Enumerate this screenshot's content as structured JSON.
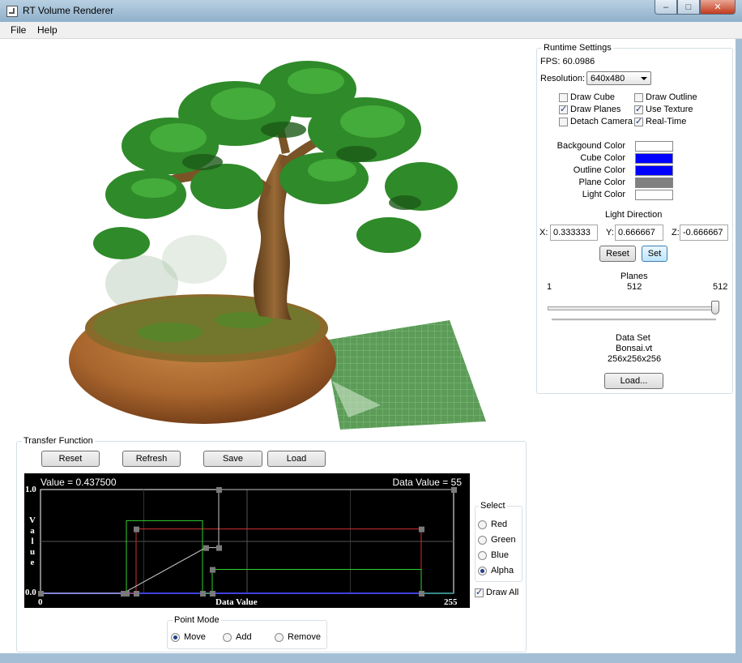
{
  "window": {
    "title": "RT Volume Renderer",
    "min": "–",
    "max": "□",
    "close": "✕"
  },
  "menu": {
    "file": "File",
    "help": "Help"
  },
  "runtime": {
    "group_label": "Runtime Settings",
    "fps": "FPS: 60.0986",
    "resolution_label": "Resolution:",
    "resolution_value": "640x480",
    "checks": {
      "draw_cube": {
        "label": "Draw Cube",
        "checked": false
      },
      "draw_outline": {
        "label": "Draw Outline",
        "checked": false
      },
      "draw_planes": {
        "label": "Draw Planes",
        "checked": true
      },
      "use_texture": {
        "label": "Use Texture",
        "checked": true
      },
      "detach_camera": {
        "label": "Detach Camera",
        "checked": false
      },
      "real_time": {
        "label": "Real-Time",
        "checked": true
      }
    },
    "colors": {
      "background": {
        "label": "Backgound Color",
        "value": "#ffffff"
      },
      "cube": {
        "label": "Cube Color",
        "value": "#0000ff"
      },
      "outline": {
        "label": "Outline Color",
        "value": "#0000ff"
      },
      "plane": {
        "label": "Plane Color",
        "value": "#808080"
      },
      "light": {
        "label": "Light Color",
        "value": "#ffffff"
      }
    },
    "light_direction": {
      "label": "Light Direction",
      "x_label": "X:",
      "x": "0.333333",
      "y_label": "Y:",
      "y": "0.666667",
      "z_label": "Z:",
      "z": "-0.666667",
      "reset": "Reset",
      "set": "Set"
    },
    "planes": {
      "label": "Planes",
      "min": "1",
      "current": "512",
      "max": "512",
      "level": 1.0
    },
    "dataset": {
      "label": "Data Set",
      "name": "Bonsai.vt",
      "dims": "256x256x256",
      "load": "Load..."
    }
  },
  "transfer": {
    "group_label": "Transfer Function",
    "reset": "Reset",
    "refresh": "Refresh",
    "save": "Save",
    "load": "Load",
    "value_readout": "Value = 0.437500",
    "data_value_readout": "Data Value = 55",
    "y_top": "1.0",
    "y_bottom": "0.0",
    "y_axis_label": [
      "V",
      "a",
      "l",
      "u",
      "e"
    ],
    "x_min": "0",
    "x_max": "255",
    "x_axis_label": "Data Value",
    "select": {
      "label": "Select",
      "options": [
        {
          "label": "Red",
          "checked": false
        },
        {
          "label": "Green",
          "checked": false
        },
        {
          "label": "Blue",
          "checked": false
        },
        {
          "label": "Alpha",
          "checked": true
        }
      ]
    },
    "draw_all": {
      "label": "Draw All",
      "checked": true
    },
    "point_mode": {
      "label": "Point Mode",
      "move": "Move",
      "add": "Add",
      "remove": "Remove",
      "selected": "Move"
    },
    "channel_colors": {
      "red": "#d03030",
      "green": "#30d030",
      "blue": "#4040e0",
      "alpha": "#c8c8c8"
    },
    "curves": {
      "red": [
        [
          0,
          0
        ],
        [
          59,
          0
        ],
        [
          59,
          0.62
        ],
        [
          235,
          0.62
        ],
        [
          235,
          0
        ],
        [
          255,
          0
        ]
      ],
      "green": [
        [
          0,
          0
        ],
        [
          53,
          0
        ],
        [
          53,
          0.7
        ],
        [
          100,
          0.7
        ],
        [
          100,
          0
        ],
        [
          106,
          0
        ],
        [
          106,
          0.23
        ],
        [
          235,
          0.23
        ],
        [
          235,
          0
        ],
        [
          255,
          0
        ]
      ],
      "alpha": [
        [
          0,
          0
        ],
        [
          51,
          0
        ],
        [
          102,
          0.44
        ],
        [
          110,
          0.44
        ],
        [
          110,
          1.0
        ],
        [
          255,
          1.0
        ]
      ]
    }
  }
}
